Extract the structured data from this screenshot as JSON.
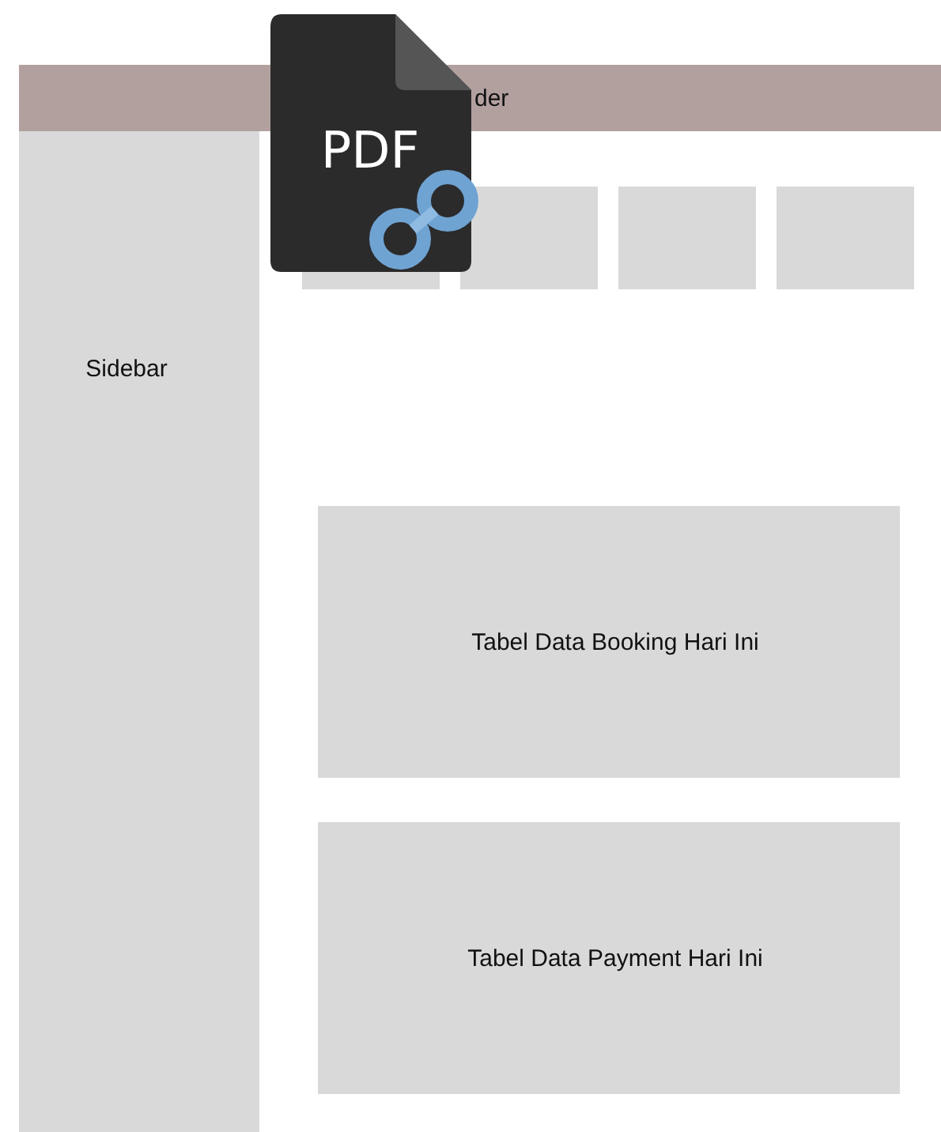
{
  "header": {
    "title": "der"
  },
  "sidebar": {
    "title": "Sidebar"
  },
  "summary_cards": [
    {
      "kind": "placeholder"
    },
    {
      "kind": "placeholder"
    },
    {
      "kind": "placeholder"
    },
    {
      "kind": "placeholder"
    }
  ],
  "panels": [
    {
      "title": "Tabel Data Booking Hari Ini"
    },
    {
      "title": "Tabel Data Payment Hari Ini"
    }
  ],
  "overlay_icon": {
    "label": "PDF"
  }
}
